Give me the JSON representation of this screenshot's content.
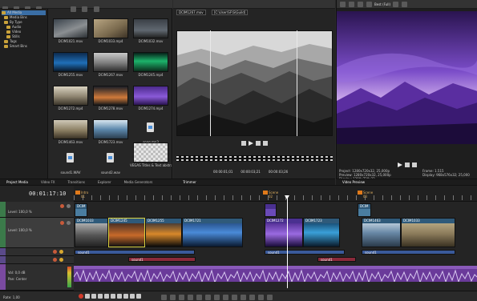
{
  "project_media": {
    "tree": [
      "All Media",
      "Media Bins",
      "By Type",
      "Audio",
      "Video",
      "Stills",
      "Tags",
      "Smart Bins"
    ],
    "items": [
      {
        "label": "DCIM1021.mov"
      },
      {
        "label": "DCIM1033.mp4"
      },
      {
        "label": "DCIM1032.mov"
      },
      {
        "label": "DCIM1255.mov"
      },
      {
        "label": "DCIM1267.mov"
      },
      {
        "label": "DCIM1245.mp4"
      },
      {
        "label": "DCIM1272.mp4"
      },
      {
        "label": "DCIM1278.mov"
      },
      {
        "label": "DCIM1274.mp4"
      },
      {
        "label": "DCIM1463.mov"
      },
      {
        "label": "DCIM1723.mov"
      },
      {
        "label": "song.mp3"
      },
      {
        "label": "sound1.WAV"
      },
      {
        "label": "sound2.wav"
      },
      {
        "label": "VEGAS Titles & Text abstract"
      }
    ],
    "tabs": [
      "Project Media",
      "Video FX",
      "Transitions",
      "Explorer",
      "Media Generators"
    ]
  },
  "trimmer": {
    "file_name": "DCIM1267.mov",
    "file_path": "[C:\\User\\SF\\S\\Guild]",
    "times": [
      "00:00:01;01",
      "00:00:03;21",
      "00:00:03;26"
    ],
    "tab": "Trimmer"
  },
  "video_preview": {
    "quality": "Best (Full)",
    "info_left": [
      "Project: 1280x720x32, 25,000p",
      "Preview: 1280x720x32, 25,000p",
      "Display: 1280x720x32"
    ],
    "info_right": [
      "Frame: 1.515",
      "Display: 968x576x32; 25,000"
    ],
    "tab": "Video Preview"
  },
  "timeline": {
    "time": "00:01:17:10",
    "level1": "Level: 100,0 %",
    "level2": "Level: 100,0 %",
    "vol": "Vol: 0,0 dB",
    "pan": "Pan: Center",
    "markers": [
      "Intro 01",
      "Scene 02",
      "Scene 03"
    ],
    "video_clips_top": [
      "DCIM",
      "DCIM"
    ],
    "video_clips": [
      "DCIM1033",
      "DCIM1245",
      "DCIM1255",
      "DCIM1721",
      "DCIM1272",
      "DCIM1723",
      "DCIM1463",
      "DCIM1033"
    ],
    "audio_clips_blue": [
      "sound1",
      "sound1",
      "sound1"
    ],
    "audio_clips_red": [
      "sound1",
      "sound1"
    ],
    "rate": "Rate: 1,00"
  }
}
